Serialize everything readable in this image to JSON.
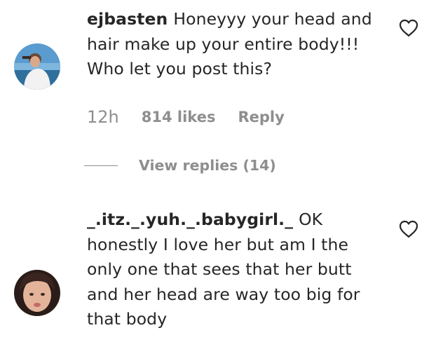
{
  "comments": [
    {
      "username": "ejbasten",
      "text": "Honeyyy your head and\nhair make up your entire body!!!\nWho let you post this?",
      "time": "12h",
      "likes": "814 likes",
      "reply_label": "Reply",
      "view_replies": "View replies (14)",
      "avatar_icon": "user-avatar-photo",
      "like_icon": "heart-outline-icon"
    },
    {
      "username": "_.itz._.yuh._.babygirl._",
      "text": "OK\nhonestly I love her but am I the\nonly one that sees that her butt\nand her head are way too big for\nthat body",
      "avatar_icon": "user-avatar-photo",
      "like_icon": "heart-outline-icon"
    }
  ],
  "colors": {
    "text": "#262626",
    "secondary": "#8e8e8e"
  }
}
